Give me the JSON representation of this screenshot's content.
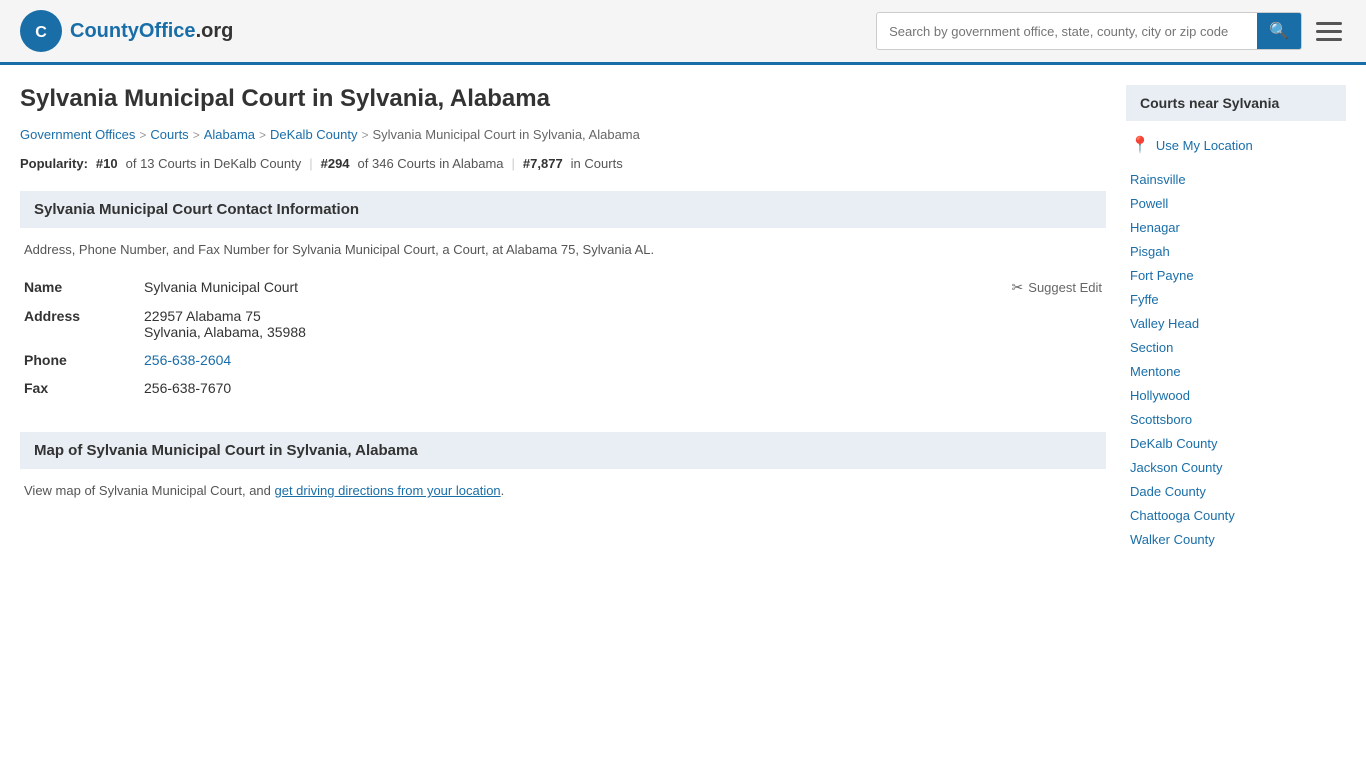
{
  "header": {
    "logo_text": "CountyOffice",
    "logo_tld": ".org",
    "search_placeholder": "Search by government office, state, county, city or zip code",
    "search_button_icon": "🔍"
  },
  "page": {
    "title": "Sylvania Municipal Court in Sylvania, Alabama",
    "breadcrumb": [
      {
        "label": "Government Offices",
        "href": "#"
      },
      {
        "label": "Courts",
        "href": "#"
      },
      {
        "label": "Alabama",
        "href": "#"
      },
      {
        "label": "DeKalb County",
        "href": "#"
      },
      {
        "label": "Sylvania Municipal Court in Sylvania, Alabama",
        "href": "#"
      }
    ],
    "popularity": {
      "label": "Popularity:",
      "rank1": "#10",
      "rank1_text": "of 13 Courts in DeKalb County",
      "rank2": "#294",
      "rank2_text": "of 346 Courts in Alabama",
      "rank3": "#7,877",
      "rank3_text": "in Courts"
    },
    "contact_section": {
      "header": "Sylvania Municipal Court Contact Information",
      "description": "Address, Phone Number, and Fax Number for Sylvania Municipal Court, a Court, at Alabama 75, Sylvania AL.",
      "fields": {
        "name_label": "Name",
        "name_value": "Sylvania Municipal Court",
        "address_label": "Address",
        "address_line1": "22957 Alabama 75",
        "address_line2": "Sylvania, Alabama, 35988",
        "phone_label": "Phone",
        "phone_value": "256-638-2604",
        "fax_label": "Fax",
        "fax_value": "256-638-7670",
        "suggest_edit": "Suggest Edit"
      }
    },
    "map_section": {
      "header": "Map of Sylvania Municipal Court in Sylvania, Alabama",
      "description_start": "View map of Sylvania Municipal Court, and ",
      "directions_link": "get driving directions from your location",
      "description_end": "."
    }
  },
  "sidebar": {
    "header": "Courts near Sylvania",
    "use_location": "Use My Location",
    "links": [
      "Rainsville",
      "Powell",
      "Henagar",
      "Pisgah",
      "Fort Payne",
      "Fyffe",
      "Valley Head",
      "Section",
      "Mentone",
      "Hollywood",
      "Scottsboro",
      "DeKalb County",
      "Jackson County",
      "Dade County",
      "Chattooga County",
      "Walker County"
    ]
  }
}
